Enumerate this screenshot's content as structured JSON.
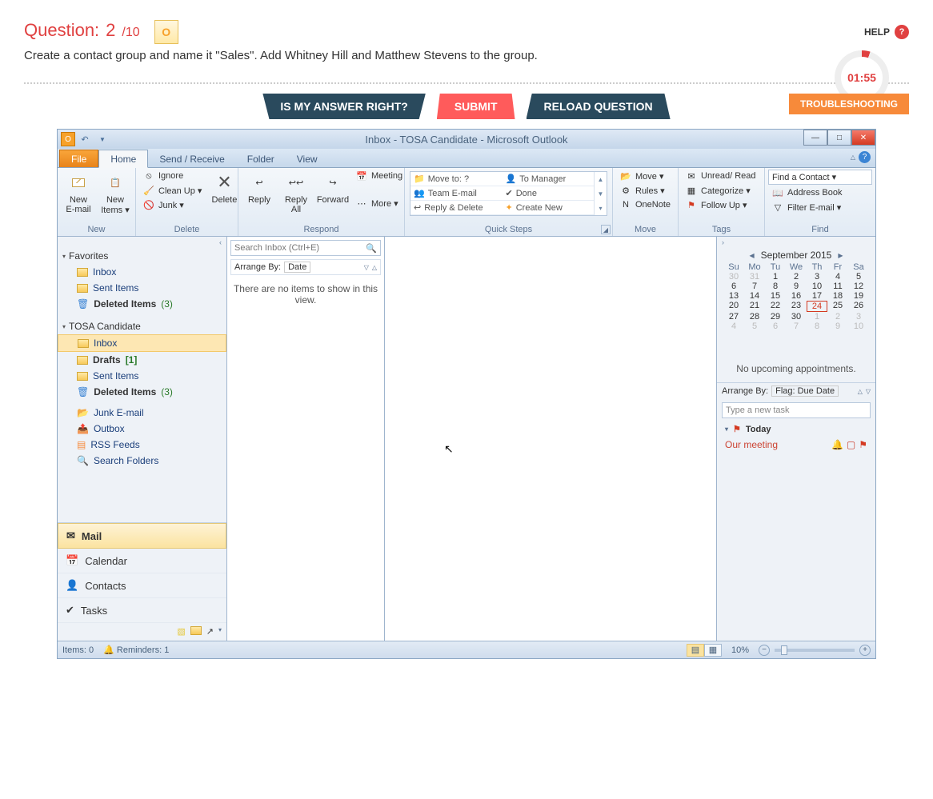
{
  "header": {
    "question_label": "Question:",
    "current": "2",
    "total": "/10",
    "help": "HELP",
    "timer": "01:55"
  },
  "instruction": "Create a contact group and name it \"Sales\". Add Whitney Hill and Matthew Stevens to the group.",
  "buttons": {
    "check": "IS MY ANSWER RIGHT?",
    "submit": "SUBMIT",
    "reload": "RELOAD QUESTION",
    "troubleshoot": "TROUBLESHOOTING"
  },
  "outlook": {
    "title": "Inbox - TOSA Candidate  -  Microsoft Outlook",
    "tabs": {
      "file": "File",
      "home": "Home",
      "sendreceive": "Send / Receive",
      "folder": "Folder",
      "view": "View"
    },
    "ribbon": {
      "new": {
        "label": "New",
        "new_email": "New\nE-mail",
        "new_items": "New\nItems ▾"
      },
      "delete": {
        "label": "Delete",
        "ignore": "Ignore",
        "cleanup": "Clean Up ▾",
        "junk": "Junk ▾",
        "delete_btn": "Delete"
      },
      "respond": {
        "label": "Respond",
        "reply": "Reply",
        "replyall": "Reply\nAll",
        "forward": "Forward",
        "meeting": "Meeting",
        "more": "More ▾"
      },
      "quicksteps": {
        "label": "Quick Steps",
        "items": [
          "Move to: ?",
          "Team E-mail",
          "Reply & Delete",
          "To Manager",
          "Done",
          "Create New"
        ]
      },
      "move": {
        "label": "Move",
        "move_btn": "Move ▾",
        "rules": "Rules ▾",
        "onenote": "OneNote"
      },
      "tags": {
        "label": "Tags",
        "unread": "Unread/ Read",
        "categorize": "Categorize ▾",
        "followup": "Follow Up ▾"
      },
      "find": {
        "label": "Find",
        "find_contact": "Find a Contact ▾",
        "address_book": "Address Book",
        "filter": "Filter E-mail ▾"
      }
    },
    "nav": {
      "favorites_hdr": "Favorites",
      "favorites": [
        {
          "label": "Inbox"
        },
        {
          "label": "Sent Items"
        },
        {
          "label": "Deleted Items",
          "count": "(3)"
        }
      ],
      "account_hdr": "TOSA Candidate",
      "folders": [
        {
          "label": "Inbox",
          "sel": true
        },
        {
          "label": "Drafts",
          "count": "[1]",
          "bold": true
        },
        {
          "label": "Sent Items"
        },
        {
          "label": "Deleted Items",
          "count": "(3)"
        },
        {
          "label": "Junk E-mail"
        },
        {
          "label": "Outbox"
        },
        {
          "label": "RSS Feeds"
        },
        {
          "label": "Search Folders"
        }
      ],
      "modules": {
        "mail": "Mail",
        "calendar": "Calendar",
        "contacts": "Contacts",
        "tasks": "Tasks"
      }
    },
    "list": {
      "search_placeholder": "Search Inbox (Ctrl+E)",
      "arrange_label": "Arrange By:",
      "arrange_value": "Date",
      "empty": "There are no items to show in this view."
    },
    "todobar": {
      "month": "September 2015",
      "dow": [
        "Su",
        "Mo",
        "Tu",
        "We",
        "Th",
        "Fr",
        "Sa"
      ],
      "weeks": [
        [
          "30",
          "31",
          "1",
          "2",
          "3",
          "4",
          "5"
        ],
        [
          "6",
          "7",
          "8",
          "9",
          "10",
          "11",
          "12"
        ],
        [
          "13",
          "14",
          "15",
          "16",
          "17",
          "18",
          "19"
        ],
        [
          "20",
          "21",
          "22",
          "23",
          "24",
          "25",
          "26"
        ],
        [
          "27",
          "28",
          "29",
          "30",
          "1",
          "2",
          "3"
        ],
        [
          "4",
          "5",
          "6",
          "7",
          "8",
          "9",
          "10"
        ]
      ],
      "today": "24",
      "no_appt": "No upcoming appointments.",
      "task_arrange_label": "Arrange By:",
      "task_arrange_value": "Flag: Due Date",
      "task_input": "Type a new task",
      "task_group": "Today",
      "task_item": "Our meeting"
    },
    "status": {
      "items": "Items: 0",
      "reminders": "Reminders: 1",
      "zoom": "10%"
    }
  }
}
